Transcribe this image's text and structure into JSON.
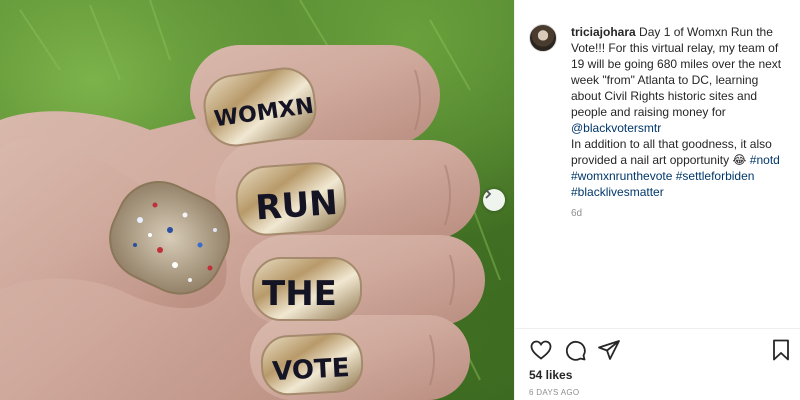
{
  "post": {
    "username": "triciajohara",
    "caption_lines": [
      " Day 1 of Womxn Run the Vote!!! For this virtual relay, my team of 19 will be going 680 miles over the next week \"from\" Atlanta to DC, learning about Civil Rights historic sites and people and raising money for "
    ],
    "mention": "@blackvotersmtr",
    "caption_tail": "In addition to all that goodness, it also provided a nail art opportunity 😂 ",
    "hashtags": [
      "#notd",
      "#womxnrunthevote",
      "#settleforbiden",
      "#blacklivesmatter"
    ],
    "age": "6d",
    "likes": "54 likes",
    "posted": "6 DAYS AGO"
  },
  "photo": {
    "nail_words": [
      "WOMXN",
      "RUN",
      "THE",
      "VOTE"
    ]
  },
  "icons": {
    "like": "heart-icon",
    "comment": "comment-icon",
    "share": "share-icon",
    "save": "bookmark-icon",
    "next": "chevron-right-icon"
  },
  "colors": {
    "link": "#00376b",
    "text": "#262626",
    "muted": "#8e8e8e"
  }
}
